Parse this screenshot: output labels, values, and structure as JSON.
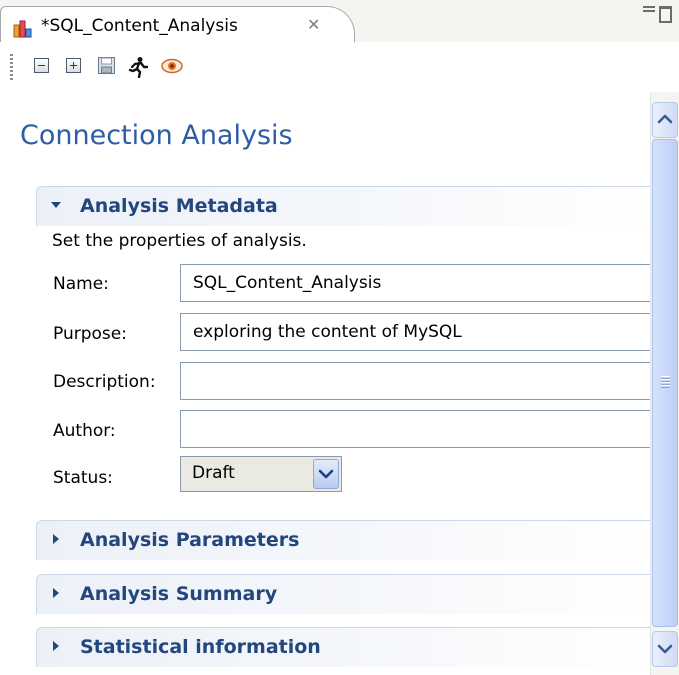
{
  "tab": {
    "title": "*SQL_Content_Analysis",
    "close_glyph": "✕"
  },
  "toolbar": {
    "icons": [
      "collapse-all-icon",
      "expand-all-icon",
      "save-icon",
      "run-icon",
      "eye-icon"
    ]
  },
  "page": {
    "title": "Connection Analysis"
  },
  "sections": {
    "metadata": {
      "title": "Analysis Metadata",
      "description": "Set the properties of analysis.",
      "expanded": true
    },
    "parameters": {
      "title": "Analysis Parameters",
      "expanded": false
    },
    "summary": {
      "title": "Analysis Summary",
      "expanded": false
    },
    "statistics": {
      "title": "Statistical information",
      "expanded": false
    }
  },
  "form": {
    "name_label": "Name:",
    "name_value": "SQL_Content_Analysis",
    "purpose_label": "Purpose:",
    "purpose_value": "exploring the content of MySQL",
    "description_label": "Description:",
    "description_value": "",
    "author_label": "Author:",
    "author_value": "",
    "status_label": "Status:",
    "status_value": "Draft"
  },
  "colors": {
    "title_blue": "#2e5da6",
    "section_text": "#22467d",
    "section_bg": "#ecf1f8"
  }
}
